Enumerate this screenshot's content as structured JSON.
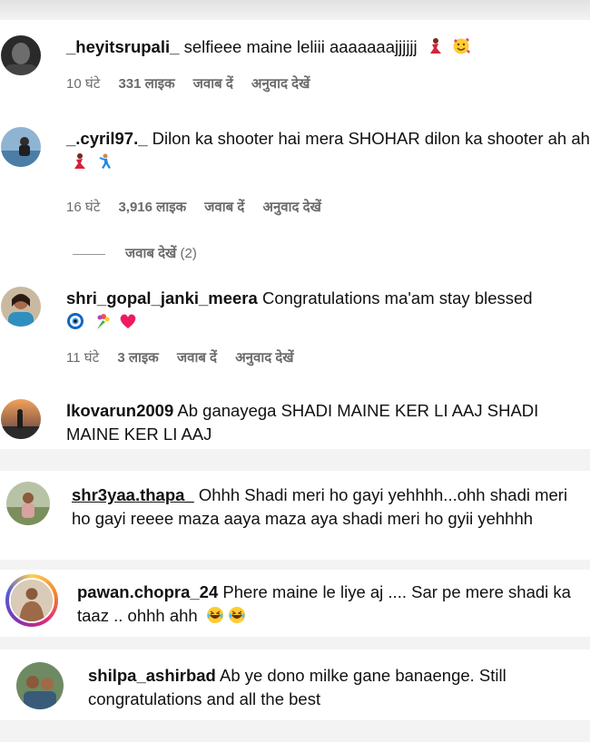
{
  "comments": [
    {
      "username": "_heyitsrupali_",
      "text": "selfieee maine leliii aaaaaaajjjjjj",
      "time": "10 घंटे",
      "likes": "331 लाइक",
      "reply_label": "जवाब दें",
      "translate_label": "अनुवाद देखें",
      "emojis": [
        "dancer-emoji",
        "smiling-hearts-emoji"
      ]
    },
    {
      "username": "_.cyril97._",
      "text": "Dilon ka shooter hai mera SHOHAR dilon ka shooter ah ah",
      "time": "16 घंटे",
      "likes": "3,916 लाइक",
      "reply_label": "जवाब दें",
      "translate_label": "अनुवाद देखें",
      "emojis": [
        "dancer-emoji",
        "man-dancing-emoji"
      ],
      "view_replies": "जवाब देखें",
      "replies_count": "(2)"
    },
    {
      "username": "shri_gopal_janki_meera",
      "text": "Congratulations ma'am stay blessed",
      "time": "11 घंटे",
      "likes": "3 लाइक",
      "reply_label": "जवाब दें",
      "translate_label": "अनुवाद देखें",
      "emojis": [
        "nazar-amulet-emoji",
        "bouquet-emoji",
        "heart-emoji"
      ]
    },
    {
      "username": "lkovarun2009",
      "text": "Ab ganayega SHADI MAINE KER LI AAJ SHADI MAINE KER LI AAJ"
    },
    {
      "username": "shr3yaa.thapa_",
      "text": "Ohhh Shadi meri ho gayi yehhhh...ohh shadi meri ho gayi reeee maza aaya maza aya shadi meri ho gyii yehhhh"
    },
    {
      "username": "pawan.chopra_24",
      "text": "Phere maine le liye aj .... Sar pe mere shadi ka taaz .. ohhh ahh",
      "emojis": [
        "laughing-emoji",
        "laughing-emoji"
      ]
    },
    {
      "username": "shilpa_ashirbad",
      "text": "Ab ye dono milke gane banaenge. Still congratulations and all the best"
    }
  ],
  "colors": {
    "meta": "#6b6b6b",
    "text": "#111111",
    "background": "#ffffff",
    "heart": "#ed1c5c"
  }
}
